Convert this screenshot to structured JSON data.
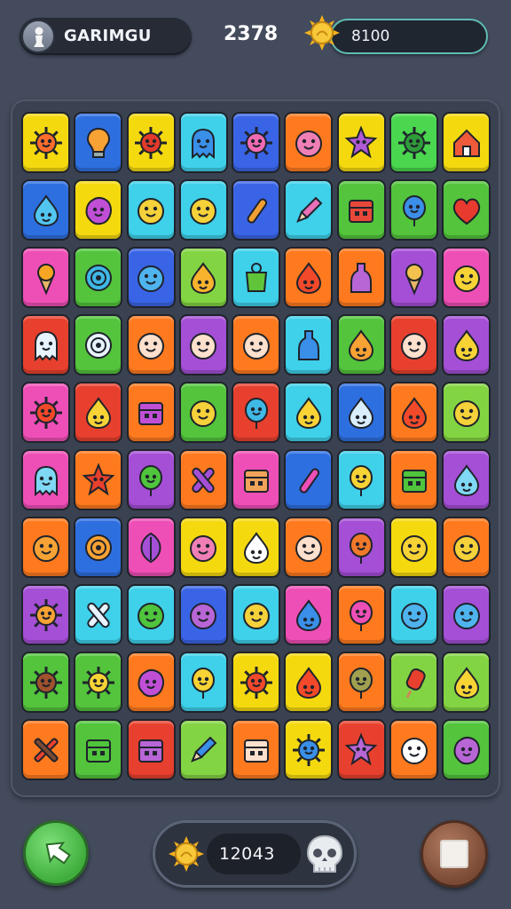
{
  "header": {
    "player_name": "GARIMGU",
    "score": "2378",
    "coins": "8100",
    "avatar_icon": "pawn-icon",
    "coin_icon": "sun-coin-icon"
  },
  "footer": {
    "counter": "12043",
    "back_icon": "arrow-back-icon",
    "counter_icon": "sun-icon",
    "right_icon": "skull-icon",
    "menu_icon": "square-icon"
  },
  "board": {
    "columns": 9,
    "rows": 10,
    "tiles": [
      [
        "#f5d90f",
        "sun",
        "#ff6d2d"
      ],
      [
        "#2e6fe0",
        "bulb",
        "#f7a234"
      ],
      [
        "#f5d90f",
        "sun",
        "#e23b2b"
      ],
      [
        "#3fd0ea",
        "ghost",
        "#3a8fe8"
      ],
      [
        "#3a64e6",
        "sun",
        "#f06bb4"
      ],
      [
        "#ff7a1f",
        "face",
        "#f07fb6"
      ],
      [
        "#f5d90f",
        "star",
        "#b05ad6"
      ],
      [
        "#4ad64e",
        "sun",
        "#2f9a3a"
      ],
      [
        "#f5d90f",
        "house",
        "#ee5a3a"
      ],
      [
        "#2e6fe0",
        "drop",
        "#52c6f0"
      ],
      [
        "#f5d90f",
        "blob",
        "#c04fd6"
      ],
      [
        "#3fd0ea",
        "face",
        "#f5d13a"
      ],
      [
        "#3fd0ea",
        "face",
        "#f5d13a"
      ],
      [
        "#3a64e6",
        "stick",
        "#f0a033"
      ],
      [
        "#3fd0ea",
        "pencil",
        "#e870b8"
      ],
      [
        "#53c43c",
        "box",
        "#e8483a"
      ],
      [
        "#53c43c",
        "balloon",
        "#3c8fe8"
      ],
      [
        "#53c43c",
        "heart",
        "#e83a2e"
      ],
      [
        "#ee4fb6",
        "cone",
        "#f5a623"
      ],
      [
        "#53c43c",
        "ring",
        "#3fb8e6"
      ],
      [
        "#3a64e6",
        "face",
        "#4fb4ee"
      ],
      [
        "#83d443",
        "drop",
        "#f7b32e"
      ],
      [
        "#3fd0ea",
        "cup",
        "#5fc43a"
      ],
      [
        "#ff7a1f",
        "drop",
        "#f2492a"
      ],
      [
        "#ff7a1f",
        "bottle",
        "#b866d6"
      ],
      [
        "#a44fd6",
        "cone",
        "#f2c14e"
      ],
      [
        "#ee4fb6",
        "face",
        "#f7d335"
      ],
      [
        "#e8402e",
        "ghost",
        "#e7f3ff"
      ],
      [
        "#53c43c",
        "ring",
        "#e7f3ff"
      ],
      [
        "#ff7a1f",
        "face",
        "#ffe0cc"
      ],
      [
        "#a44fd6",
        "face",
        "#ffe0cc"
      ],
      [
        "#ff7a1f",
        "face",
        "#ffe0cc"
      ],
      [
        "#3fd0ea",
        "bottle",
        "#3a8fe8"
      ],
      [
        "#53c43c",
        "drop",
        "#f7a234"
      ],
      [
        "#e8402e",
        "face",
        "#ffe0cc"
      ],
      [
        "#a44fd6",
        "drop",
        "#f7d335"
      ],
      [
        "#ee4fb6",
        "sun",
        "#f2492a"
      ],
      [
        "#e8402e",
        "drop",
        "#f7d335"
      ],
      [
        "#ff7a1f",
        "box",
        "#c04fd6"
      ],
      [
        "#53c43c",
        "face",
        "#f5d13a"
      ],
      [
        "#e8402e",
        "balloon",
        "#3fb8e6"
      ],
      [
        "#3fd0ea",
        "drop",
        "#f7d335"
      ],
      [
        "#2e6fe0",
        "drop",
        "#d9eefc"
      ],
      [
        "#ff7a1f",
        "drop",
        "#f2492a"
      ],
      [
        "#83d443",
        "face",
        "#f5d13a"
      ],
      [
        "#ee4fb6",
        "ghost",
        "#7fd8f4"
      ],
      [
        "#ff7a1f",
        "star",
        "#e8402e"
      ],
      [
        "#a44fd6",
        "balloon",
        "#4fc43c"
      ],
      [
        "#ff7a1f",
        "bone",
        "#a44fd6"
      ],
      [
        "#ee4fb6",
        "box",
        "#f2a35a"
      ],
      [
        "#2e6fe0",
        "stick",
        "#ee4fb6"
      ],
      [
        "#3fd0ea",
        "balloon",
        "#f7d335"
      ],
      [
        "#ff7a1f",
        "box",
        "#4fc43c"
      ],
      [
        "#a44fd6",
        "drop",
        "#7fd8f4"
      ],
      [
        "#ff7a1f",
        "face",
        "#f7a234"
      ],
      [
        "#2e6fe0",
        "ring",
        "#f7a234"
      ],
      [
        "#ee4fb6",
        "leaf",
        "#a44fd6"
      ],
      [
        "#f5d90f",
        "face",
        "#f07fb6"
      ],
      [
        "#f5d90f",
        "drop",
        "#ffffff"
      ],
      [
        "#ff7a1f",
        "face",
        "#ffe0cc"
      ],
      [
        "#a44fd6",
        "balloon",
        "#f2792a"
      ],
      [
        "#f5d90f",
        "face",
        "#f7d335"
      ],
      [
        "#ff7a1f",
        "face",
        "#f5d13a"
      ],
      [
        "#a44fd6",
        "sun",
        "#f7a234"
      ],
      [
        "#3fd0ea",
        "bone",
        "#e7f3ff"
      ],
      [
        "#3fd0ea",
        "face",
        "#4fc43c"
      ],
      [
        "#3a64e6",
        "face",
        "#b866d6"
      ],
      [
        "#3fd0ea",
        "face",
        "#f5d13a"
      ],
      [
        "#ee4fb6",
        "drop",
        "#3a8fe8"
      ],
      [
        "#ff7a1f",
        "balloon",
        "#ee4fb6"
      ],
      [
        "#3fd0ea",
        "face",
        "#4fb4ee"
      ],
      [
        "#a44fd6",
        "face",
        "#4fb4ee"
      ],
      [
        "#53c43c",
        "sun",
        "#a0522d"
      ],
      [
        "#53c43c",
        "sun",
        "#f7d335"
      ],
      [
        "#ff7a1f",
        "blob",
        "#c04fd6"
      ],
      [
        "#3fd0ea",
        "balloon",
        "#f7d335"
      ],
      [
        "#f5d90f",
        "sun",
        "#f2492a"
      ],
      [
        "#f5d90f",
        "drop",
        "#f2492a"
      ],
      [
        "#ff7a1f",
        "balloon",
        "#a0a050"
      ],
      [
        "#83d443",
        "pop",
        "#e8402e"
      ],
      [
        "#83d443",
        "drop",
        "#f7d335"
      ],
      [
        "#ff7a1f",
        "tool",
        "#e8402e"
      ],
      [
        "#53c43c",
        "box",
        "#4fc43c"
      ],
      [
        "#e8402e",
        "box",
        "#b866d6"
      ],
      [
        "#83d443",
        "pencil",
        "#3a8fe8"
      ],
      [
        "#ff7a1f",
        "box",
        "#ffe0cc"
      ],
      [
        "#f5d90f",
        "sun",
        "#3a8fe8"
      ],
      [
        "#e8402e",
        "star",
        "#b866d6"
      ],
      [
        "#ff7a1f",
        "face",
        "#ffffff"
      ],
      [
        "#53c43c",
        "blob",
        "#b866d6"
      ]
    ]
  }
}
